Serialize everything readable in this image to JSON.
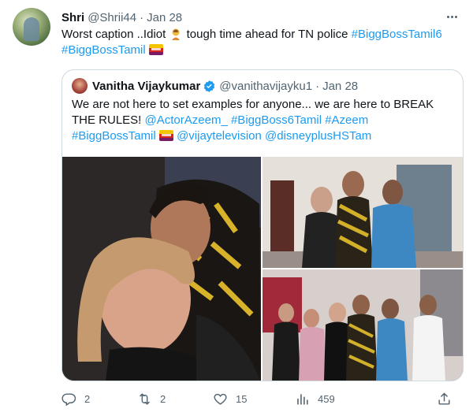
{
  "tweet": {
    "author_name": "Shri",
    "author_handle": "@Shrii44",
    "separator": "·",
    "date": "Jan 28",
    "text_before": "Worst caption ..Idiot",
    "text_after": " tough time ahead for TN police ",
    "hashtag1": "#BiggBossTamil6",
    "hashtag2": "#BiggBossTamil"
  },
  "quote": {
    "author_name": "Vanitha Vijaykumar",
    "author_handle": "@vanithavijayku1",
    "separator": "·",
    "date": "Jan 28",
    "line1": "We are not here to set examples for anyone... we are here to BREAK",
    "line2_start": "THE RULES! ",
    "mention1": "@ActorAzeem_",
    "hashtag1": "#BiggBoss6Tamil",
    "hashtag2": "#Azeem",
    "hashtag3": "#BiggBossTamil",
    "mention2": "@vijaytelevision",
    "mention3": "@disneyplusHSTam"
  },
  "actions": {
    "replies": "2",
    "retweets": "2",
    "likes": "15",
    "views": "459"
  },
  "icons": {
    "more": "more-horizontal-icon",
    "reply": "reply-icon",
    "retweet": "retweet-icon",
    "like": "heart-icon",
    "views": "analytics-icon",
    "share": "share-icon",
    "verified": "verified-badge-icon"
  },
  "colors": {
    "link": "#1d9bf0",
    "secondary_text": "#536471",
    "border": "#cfd9de"
  }
}
